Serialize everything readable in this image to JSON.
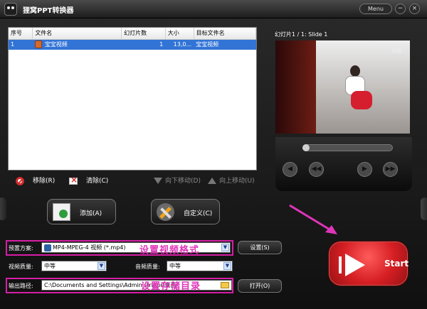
{
  "window": {
    "title": "狸窝PPT转换器",
    "menu_label": "Menu",
    "minimize_label": "−",
    "close_label": "×"
  },
  "file_table": {
    "columns": [
      "序号",
      "文件名",
      "幻灯片数",
      "大小",
      "目标文件名"
    ],
    "rows": [
      {
        "index": "1",
        "filename": "宝宝视频",
        "slides": "1",
        "size": "13,0...",
        "target": "宝宝视频",
        "selected": true
      }
    ]
  },
  "list_toolbar": {
    "remove": "移除(R)",
    "clear": "清除(C)",
    "move_down": "向下移动(D)",
    "move_up": "向上移动(U)"
  },
  "preview": {
    "label": "幻灯片1 / 1: Slide 1",
    "watermark": "优酷",
    "progress": 0.05,
    "buttons": [
      "previous",
      "rewind",
      "play",
      "next"
    ]
  },
  "actions": {
    "add": "添加(A)",
    "customize": "自定义(C)"
  },
  "settings": {
    "preset_label": "预置方案:",
    "preset_value": "MP4-MPEG-4 视频 (*.mp4)",
    "settings_button": "设置(S)",
    "video_quality_label": "视频质量:",
    "video_quality_value": "中等",
    "audio_quality_label": "音频质量:",
    "audio_quality_value": "中等",
    "output_path_label": "输出路径:",
    "output_path_value": "C:\\Documents and Settings\\Administrator\\桌面",
    "open_button": "打开(O)"
  },
  "annotations": {
    "video_format": "设置视频格式",
    "storage_directory": "设置存储目录"
  },
  "start": {
    "label": "Start"
  },
  "colors": {
    "selection": "#3274d6",
    "highlight": "#d61ea5",
    "start": "#d61f24"
  },
  "icons": [
    "app-logo-icon",
    "ppt-icon",
    "remove-icon",
    "clear-icon",
    "arrow-down-icon",
    "arrow-up-icon",
    "add-icon",
    "tools-icon",
    "video-icon",
    "folder-icon",
    "start-icon"
  ]
}
